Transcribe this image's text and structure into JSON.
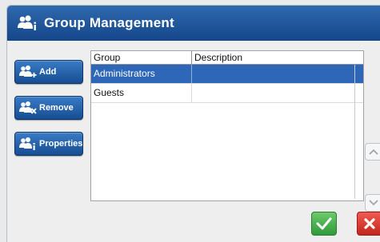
{
  "dialog": {
    "title": "Group Management",
    "title_icon": "group-info-icon"
  },
  "sidebar": {
    "add_label": "Add",
    "remove_label": "Remove",
    "properties_label": "Properties"
  },
  "table": {
    "columns": [
      "Group",
      "Description"
    ],
    "rows": [
      {
        "group": "Administrators",
        "description": "",
        "selected": true
      },
      {
        "group": "Guests",
        "description": "",
        "selected": false
      }
    ]
  },
  "colors": {
    "title_bar": "#1f559c",
    "selection": "#2e67b8",
    "ok": "#3aa845",
    "cancel": "#d9332a"
  },
  "icons": {
    "add": "group-add-icon",
    "remove": "group-remove-icon",
    "properties": "group-info-icon",
    "scroll_up": "chevron-up-icon",
    "scroll_down": "chevron-down-icon",
    "ok": "checkmark-icon",
    "cancel": "close-icon"
  }
}
